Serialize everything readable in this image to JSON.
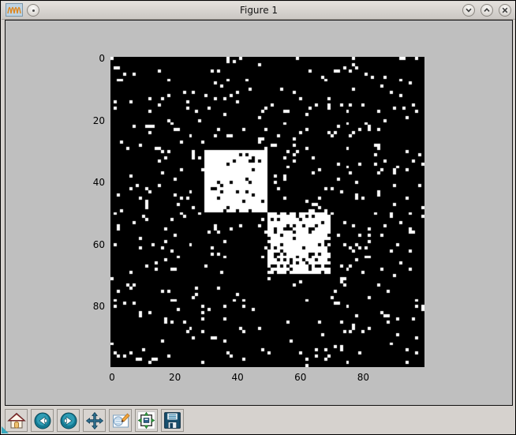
{
  "window": {
    "title": "Figure 1",
    "controls": [
      {
        "name": "window-menu",
        "icon": "dot-icon"
      },
      {
        "name": "minimize",
        "icon": "chevron-down-icon"
      },
      {
        "name": "maximize",
        "icon": "chevron-up-icon"
      },
      {
        "name": "close",
        "icon": "x-icon"
      }
    ]
  },
  "toolbar": {
    "buttons": [
      {
        "name": "home",
        "icon": "home-icon"
      },
      {
        "name": "back",
        "icon": "back-arrow-icon"
      },
      {
        "name": "forward",
        "icon": "forward-arrow-icon"
      },
      {
        "name": "pan",
        "icon": "move-arrows-icon"
      },
      {
        "name": "zoom-to-rect",
        "icon": "magnifier-pencil-icon"
      },
      {
        "name": "configure-subplots",
        "icon": "subplots-icon"
      },
      {
        "name": "save",
        "icon": "floppy-disk-icon"
      }
    ]
  },
  "chart_data": {
    "type": "heatmap",
    "title": "",
    "xlabel": "",
    "ylabel": "",
    "size": 100,
    "xticks": [
      0,
      20,
      40,
      60,
      80
    ],
    "yticks": [
      0,
      20,
      40,
      60,
      80
    ],
    "xlim": [
      -0.5,
      99.5
    ],
    "ylim": [
      99.5,
      -0.5
    ],
    "grid": false,
    "colors": {
      "background": "#000000",
      "foreground": "#ffffff",
      "figure_bg": "#bfbfbf"
    },
    "noise_white_density": 0.048,
    "blocks": [
      {
        "row_range": [
          30,
          50
        ],
        "col_range": [
          30,
          50
        ],
        "white_density": 0.93
      },
      {
        "row_range": [
          50,
          70
        ],
        "col_range": [
          50,
          70
        ],
        "white_density": 0.82
      }
    ],
    "seed": 7,
    "description": "Binary 100x100 matrix rendered with imshow: sparse white noise on black with two dense white 20x20 blocks on the main diagonal (rows/cols 30-50 and 50-70)"
  }
}
